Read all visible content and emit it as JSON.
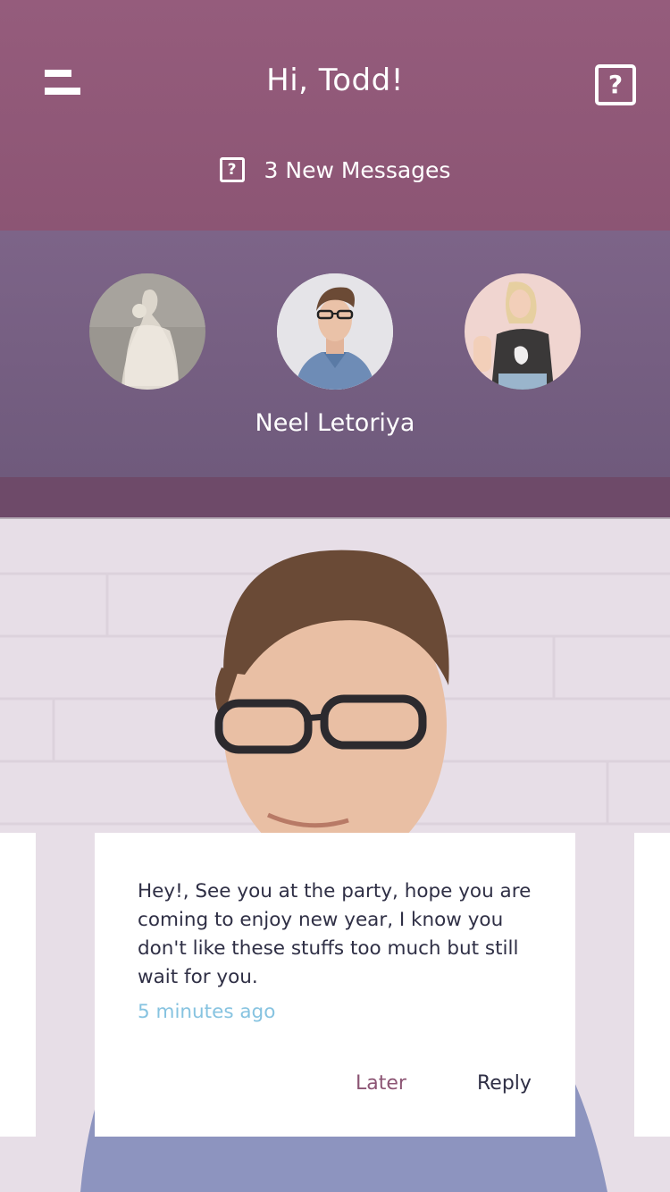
{
  "header": {
    "greeting": "Hi, Todd!",
    "menu_icon": "menu-icon",
    "help_icon": "help-icon",
    "help_icon_glyph": "?",
    "messages_icon_glyph": "?",
    "new_messages": "3 New Messages"
  },
  "contacts": {
    "selected_name": "Neel Letoriya",
    "avatars": [
      "bride-avatar",
      "neel-avatar",
      "girl-avatar"
    ]
  },
  "message_card": {
    "text": "Hey!, See you at the party, hope you are coming to enjoy new year, I know you don't like these stuffs too much but still wait for you.",
    "time": "5 minutes ago",
    "later_label": "Later",
    "reply_label": "Reply"
  },
  "colors": {
    "header": "#955c7c",
    "contacts_band": "#7d6488",
    "accent_later": "#8c5574",
    "timestamp": "#86c3e0",
    "text": "#2f2f45"
  }
}
